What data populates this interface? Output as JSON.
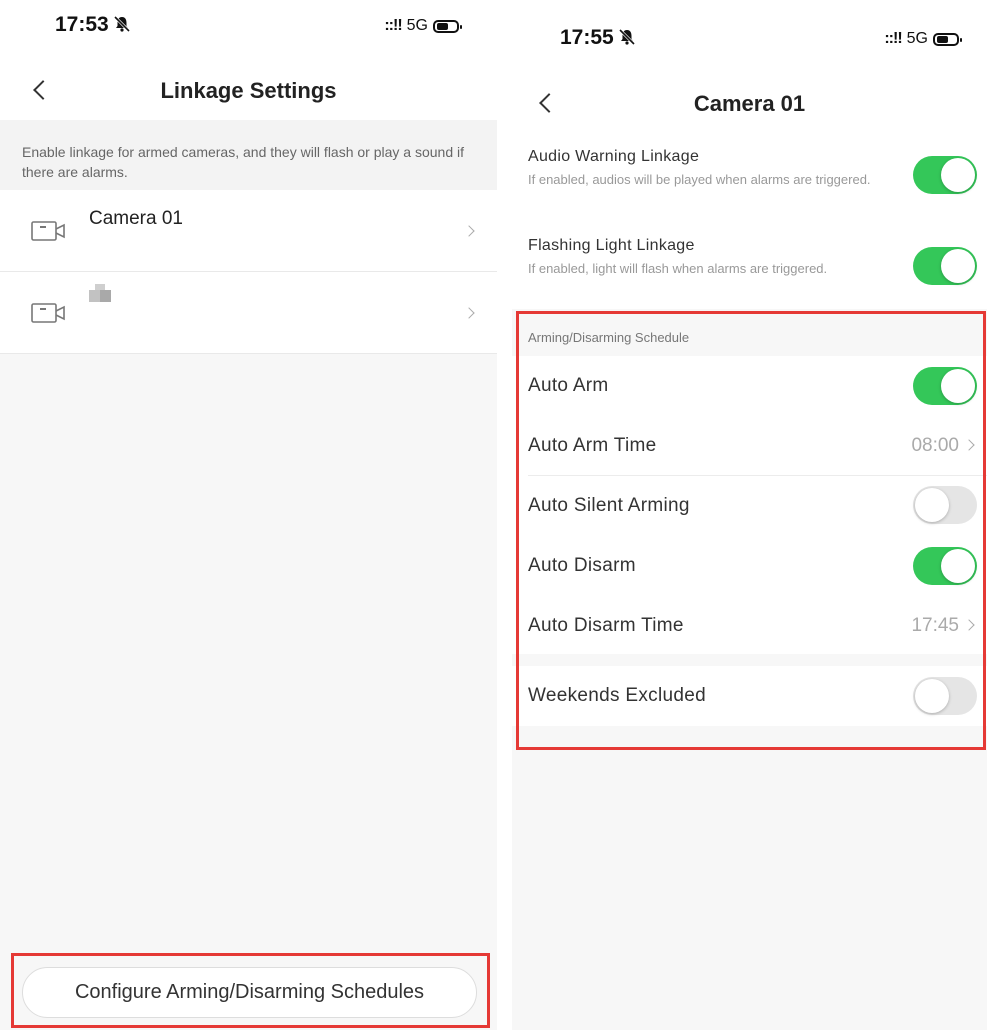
{
  "left": {
    "status": {
      "time": "17:53",
      "signal": "::!!",
      "network": "5G"
    },
    "nav": {
      "title": "Linkage Settings"
    },
    "description": "Enable linkage for armed cameras, and they will flash or play a sound if there are alarms.",
    "cameras": [
      {
        "name": "Camera 01"
      },
      {
        "name": ""
      }
    ],
    "configure_button": "Configure Arming/Disarming Schedules"
  },
  "right": {
    "status": {
      "time": "17:55",
      "signal": "::!!",
      "network": "5G"
    },
    "nav": {
      "title": "Camera 01"
    },
    "audio": {
      "label": "Audio Warning Linkage",
      "sub": "If enabled, audios will be played when alarms are triggered.",
      "on": true
    },
    "flash": {
      "label": "Flashing Light Linkage",
      "sub": "If enabled, light will flash when alarms are triggered.",
      "on": true
    },
    "schedule": {
      "header": "Arming/Disarming Schedule",
      "auto_arm": {
        "label": "Auto Arm",
        "on": true
      },
      "auto_arm_time": {
        "label": "Auto Arm Time",
        "value": "08:00"
      },
      "auto_silent": {
        "label": "Auto Silent Arming",
        "on": false
      },
      "auto_disarm": {
        "label": "Auto Disarm",
        "on": true
      },
      "auto_disarm_time": {
        "label": "Auto Disarm Time",
        "value": "17:45"
      },
      "weekends": {
        "label": "Weekends Excluded",
        "on": false
      }
    }
  },
  "colors": {
    "toggle_on": "#34c759",
    "toggle_off": "#e5e5e5",
    "highlight": "#e53935"
  }
}
